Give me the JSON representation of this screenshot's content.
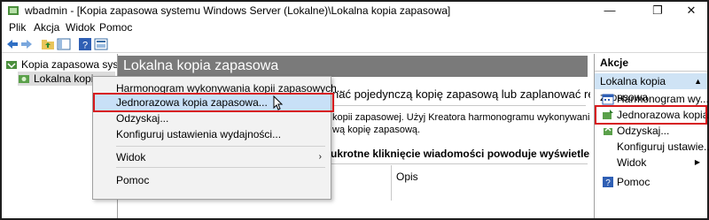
{
  "window": {
    "title": "wbadmin - [Kopia zapasowa systemu Windows Server (Lokalne)\\Lokalna kopia zapasowa]",
    "minimize": "—",
    "maximize": "❐",
    "close": "✕"
  },
  "menubar": [
    "Plik",
    "Akcja",
    "Widok",
    "Pomoc"
  ],
  "toolbar": {
    "icons": [
      "back-icon",
      "forward-icon",
      "folder-up-icon",
      "show-hide-tree-icon",
      "help-icon",
      "properties-icon"
    ]
  },
  "tree": {
    "root": "Kopia zapasowa systemu W",
    "child": "Lokalna kopia zapasowa"
  },
  "center": {
    "header": "Lokalna kopia zapasowa",
    "line1": "nać pojedynczą kopię zapasową lub zaplanować reg",
    "line2": "kopii zapasowej. Użyj Kreatora harmonogramu wykonywania kopii z",
    "line3": "wą kopię zapasową.",
    "line4": "ukrotne kliknięcie wiadomości powoduje wyświetlenie szczego",
    "column_opis": "Opis"
  },
  "context_menu": {
    "items": [
      "Harmonogram wykonywania kopii zapasowych...",
      "Jednorazowa kopia zapasowa...",
      "Odzyskaj...",
      "Konfiguruj ustawienia wydajności...",
      "Widok",
      "Pomoc"
    ],
    "highlighted_index": 1
  },
  "actions": {
    "header": "Akcje",
    "subheader": "Lokalna kopia zapasowa",
    "subheader_arrow": "▲",
    "items": [
      {
        "label": "Harmonogram wy...",
        "icon": "schedule-icon"
      },
      {
        "label": "Jednorazowa kopia...",
        "icon": "backup-once-icon"
      },
      {
        "label": "Odzyskaj...",
        "icon": "recover-icon"
      },
      {
        "label": "Konfiguruj ustawie...",
        "icon": "configure-icon"
      },
      {
        "label": "Widok",
        "icon": ""
      },
      {
        "label": "Pomoc",
        "icon": "help-icon"
      }
    ],
    "widok_arrow": "▶"
  },
  "colors": {
    "highlight_border": "#d7191c",
    "menu_highlight": "#c8e0f7",
    "header_bg": "#7a7a7a",
    "actions_sub_bg": "#cfe3f5"
  }
}
